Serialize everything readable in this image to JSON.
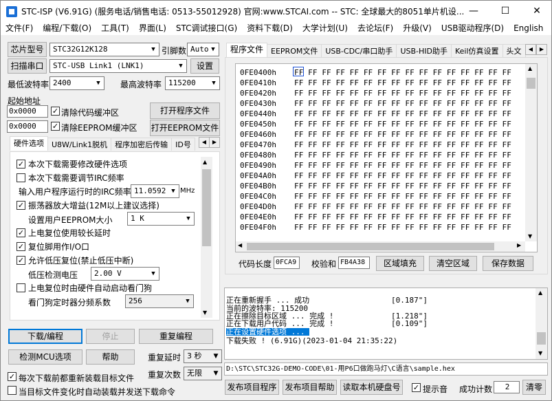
{
  "window": {
    "title": "STC-ISP (V6.91G) (服务电话/销售电话: 0513-55012928) 官网:www.STCAI.com  -- STC: 全球最大的8051单片机设...",
    "minimize": "—",
    "maximize": "☐",
    "close": "✕"
  },
  "menu": [
    "文件(F)",
    "编程/下载(O)",
    "工具(T)",
    "界面(L)",
    "STC调试接口(G)",
    "资料下载(D)",
    "大学计划(U)",
    "去论坛(F)",
    "升级(V)",
    "USB驱动程序(D)",
    "English"
  ],
  "left": {
    "chip_button": "芯片型号",
    "chip_value": "STC32G12K128",
    "pin_label": "引脚数",
    "pin_value": "Auto",
    "scan_button": "扫描串口",
    "port_value": "STC-USB Link1 (LNK1)",
    "settings_button": "设置",
    "min_baud_label": "最低波特率",
    "min_baud_value": "2400",
    "max_baud_label": "最高波特率",
    "max_baud_value": "115200",
    "start_addr_label": "起始地址",
    "addr1": "0x0000",
    "clear_code_label": "清除代码缓冲区",
    "open_prog_button": "打开程序文件",
    "addr2": "0x0000",
    "clear_eeprom_label": "清除EEPROM缓冲区",
    "open_eeprom_button": "打开EEPROM文件",
    "tabs": [
      "硬件选项",
      "U8W/Link1脱机",
      "程序加密后传输",
      "ID号"
    ],
    "hw_options": {
      "opt1": "本次下载需要修改硬件选项",
      "opt2": "本次下载需要调节IRC频率",
      "irc_label": "输入用户程序运行时的IRC频率",
      "irc_value": "11.0592",
      "irc_unit": "MHz",
      "opt3": "振荡器放大增益(12M以上建议选择)",
      "eeprom_label": "设置用户EEPROM大小",
      "eeprom_value": "1   K",
      "opt4": "上电复位使用较长延时",
      "opt5": "复位脚用作I/O口",
      "opt6": "允许低压复位(禁止低压中断)",
      "lvd_label": "低压检测电压",
      "lvd_value": "2.00 V",
      "opt7": "上电复位时由硬件自动启动看门狗",
      "wdt_label": "看门狗定时器分频系数",
      "wdt_value": "256"
    },
    "download_button": "下载/编程",
    "stop_button": "停止",
    "reprogram_button": "重复编程",
    "detect_button": "检测MCU选项",
    "help_button": "帮助",
    "repeat_delay_label": "重复延时",
    "repeat_delay_value": "3 秒",
    "repeat_count_label": "重复次数",
    "repeat_count_value": "无限",
    "reload_label": "每次下载前都重新装载目标文件",
    "autosend_label": "当目标文件变化时自动装载并发送下载命令"
  },
  "right": {
    "tabs": [
      "程序文件",
      "EEPROM文件",
      "USB-CDC/串口助手",
      "USB-HID助手",
      "Keil仿真设置",
      "头文"
    ],
    "hex_rows": [
      {
        "addr": "0FE0400h",
        "bytes": "FF FF FF FF FF FF FF FF FF FF FF FF FF FF FF FF"
      },
      {
        "addr": "0FE0410h",
        "bytes": "FF FF FF FF FF FF FF FF FF FF FF FF FF FF FF FF"
      },
      {
        "addr": "0FE0420h",
        "bytes": "FF FF FF FF FF FF FF FF FF FF FF FF FF FF FF FF"
      },
      {
        "addr": "0FE0430h",
        "bytes": "FF FF FF FF FF FF FF FF FF FF FF FF FF FF FF FF"
      },
      {
        "addr": "0FE0440h",
        "bytes": "FF FF FF FF FF FF FF FF FF FF FF FF FF FF FF FF"
      },
      {
        "addr": "0FE0450h",
        "bytes": "FF FF FF FF FF FF FF FF FF FF FF FF FF FF FF FF"
      },
      {
        "addr": "0FE0460h",
        "bytes": "FF FF FF FF FF FF FF FF FF FF FF FF FF FF FF FF"
      },
      {
        "addr": "0FE0470h",
        "bytes": "FF FF FF FF FF FF FF FF FF FF FF FF FF FF FF FF"
      },
      {
        "addr": "0FE0480h",
        "bytes": "FF FF FF FF FF FF FF FF FF FF FF FF FF FF FF FF"
      },
      {
        "addr": "0FE0490h",
        "bytes": "FF FF FF FF FF FF FF FF FF FF FF FF FF FF FF FF"
      },
      {
        "addr": "0FE04A0h",
        "bytes": "FF FF FF FF FF FF FF FF FF FF FF FF FF FF FF FF"
      },
      {
        "addr": "0FE04B0h",
        "bytes": "FF FF FF FF FF FF FF FF FF FF FF FF FF FF FF FF"
      },
      {
        "addr": "0FE04C0h",
        "bytes": "FF FF FF FF FF FF FF FF FF FF FF FF FF FF FF FF"
      },
      {
        "addr": "0FE04D0h",
        "bytes": "FF FF FF FF FF FF FF FF FF FF FF FF FF FF FF FF"
      },
      {
        "addr": "0FE04E0h",
        "bytes": "FF FF FF FF FF FF FF FF FF FF FF FF FF FF FF FF"
      },
      {
        "addr": "0FE04F0h",
        "bytes": "FF FF FF FF FF FF FF FF FF FF FF FF FF FF FF FF"
      }
    ],
    "code_len_label": "代码长度",
    "code_len_value": "0FCA9",
    "checksum_label": "校验和",
    "checksum_value": "FB4A38",
    "fill_button": "区域填充",
    "clear_button": "清空区域",
    "save_button": "保存数据",
    "log": [
      {
        "text": "正在重新握手 ... 成功",
        "time": "[0.187\"]"
      },
      {
        "text": "当前的波特率: 115200",
        "time": ""
      },
      {
        "text": "正在擦除目标区域 ... 完成 !",
        "time": "[1.218\"]"
      },
      {
        "text": "正在下载用户代码 ... 完成 !",
        "time": "[0.109\"]"
      },
      {
        "text": "正在设置硬件选项 ...",
        "time": ""
      },
      {
        "text": "下载失败 ! (6.91G)(2023-01-04 21:35:22)",
        "time": ""
      }
    ],
    "file_path": "D:\\STC\\STC32G-DEMO-CODE\\01-用P6口做跑马灯\\C语言\\sample.hex",
    "publish_prog_button": "发布项目程序",
    "publish_help_button": "发布项目帮助",
    "read_serial_button": "读取本机硬盘号",
    "beep_label": "提示音",
    "success_label": "成功计数",
    "success_value": "2",
    "clear_count_button": "清零"
  }
}
